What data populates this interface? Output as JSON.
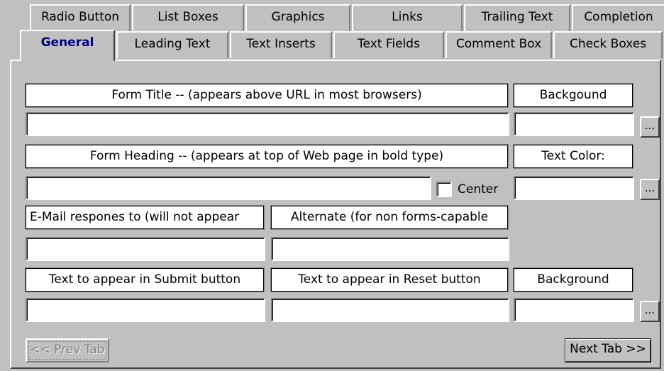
{
  "tabs_row1": [
    "Radio Button",
    "List Boxes",
    "Graphics",
    "Links",
    "Trailing Text",
    "Completion"
  ],
  "tabs_row2": [
    "General",
    "Leading Text",
    "Text Inserts",
    "Text Fields",
    "Comment Box",
    "Check Boxes"
  ],
  "active_tab": "General",
  "labels": {
    "form_title": "Form Title -- (appears above URL in most browsers)",
    "background": "Backgound",
    "form_heading": "Form Heading -- (appears at top of Web page in bold type)",
    "text_color": "Text Color:",
    "email": "E-Mail respones to (will not appear",
    "alternate": "Alternate (for non forms-capable",
    "submit_text": "Text to appear in Submit button",
    "reset_text": "Text to appear in Reset button",
    "background_sound": "Background"
  },
  "center_checkbox": {
    "label": "Center",
    "checked": false
  },
  "ellipsis": "...",
  "buttons": {
    "prev": "<< Prev Tab",
    "next": "Next Tab >>"
  },
  "colors": {
    "face": "#c0c0c0",
    "active_tab_text": "#000080"
  }
}
